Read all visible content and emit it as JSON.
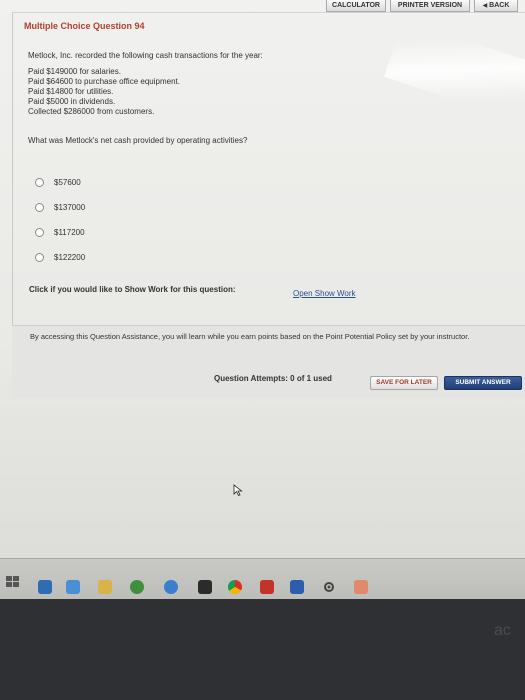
{
  "topbar": {
    "calculator": "CALCULATOR",
    "printer_version": "PRINTER VERSION",
    "back": "BACK"
  },
  "question": {
    "title": "Multiple Choice Question 94",
    "intro": "Metlock, Inc. recorded the following cash transactions for the year:",
    "transactions": [
      "Paid $149000 for salaries.",
      "Paid $64600 to purchase office equipment.",
      "Paid $14800 for utilities.",
      "Paid $5000 in dividends.",
      "Collected $286000 from customers."
    ],
    "prompt": "What was Metlock's net cash provided by operating activities?",
    "options": [
      "$57600",
      "$137000",
      "$117200",
      "$122200"
    ]
  },
  "show_work": {
    "label": "Click if you would like to Show Work for this question:",
    "link": "Open Show Work"
  },
  "assistance": {
    "text": "By accessing this Question Assistance, you will learn while you earn points based on the Point Potential Policy set by your instructor."
  },
  "footer": {
    "attempts": "Question Attempts: 0 of 1 used",
    "save_label": "SAVE FOR LATER",
    "submit_label": "SUBMIT ANSWER"
  },
  "colors": {
    "title_accent": "#b2402a",
    "submit_bg": "#2a4a84",
    "link": "#2c4f8a"
  },
  "taskbar": {
    "icons": [
      "windows-start-icon",
      "task-view-icon",
      "file-explorer-icon",
      "folder-icon",
      "xbox-icon",
      "edge-browser-icon",
      "media-icon",
      "chrome-icon",
      "acrobat-icon",
      "word-icon",
      "settings-gear-icon",
      "paint-icon"
    ]
  }
}
